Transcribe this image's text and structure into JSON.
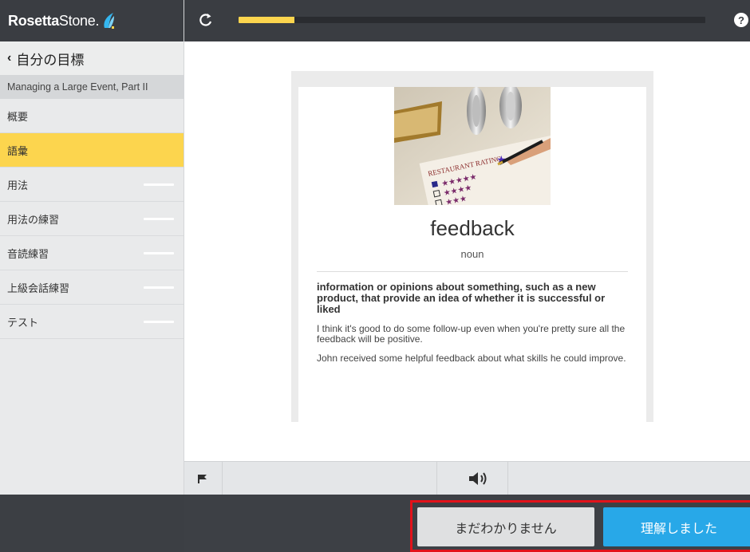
{
  "app": {
    "brand_bold": "Rosetta",
    "brand_light": "Stone",
    "brand_dot": "."
  },
  "sidebar": {
    "back_label": "自分の目標",
    "unit_title": "Managing a Large Event, Part II",
    "items": [
      {
        "label": "概要",
        "active": false,
        "has_progress": false
      },
      {
        "label": "語彙",
        "active": true,
        "has_progress": false
      },
      {
        "label": "用法",
        "active": false,
        "has_progress": true
      },
      {
        "label": "用法の練習",
        "active": false,
        "has_progress": true
      },
      {
        "label": "音読練習",
        "active": false,
        "has_progress": true
      },
      {
        "label": "上級会話練習",
        "active": false,
        "has_progress": true
      },
      {
        "label": "テスト",
        "active": false,
        "has_progress": true
      }
    ]
  },
  "topbar": {
    "progress_fraction": 0.12,
    "help_glyph": "?"
  },
  "card": {
    "image_heading": "RESTAURANT RATING",
    "word": "feedback",
    "part_of_speech": "noun",
    "definition": "information or opinions about something, such as a new product, that provide an idea of whether it is successful or liked",
    "examples": [
      "I think it's good to do some follow-up even when you're pretty sure all the feedback will be positive.",
      "John received some helpful feedback about what skills he could improve."
    ]
  },
  "toolbar": {
    "icons": [
      "flag-icon",
      "speaker-icon"
    ]
  },
  "actions": {
    "unsure_label": "まだわかりません",
    "understood_label": "理解しました"
  },
  "colors": {
    "accent_yellow": "#fcd54e",
    "primary_blue": "#28a8e8",
    "highlight_red": "#e2121a",
    "dark_chrome": "#3a3d42"
  }
}
